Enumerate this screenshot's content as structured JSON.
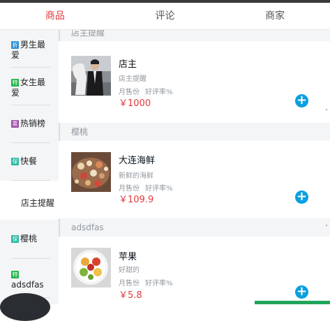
{
  "tabs": [
    {
      "label": "商品",
      "active": true
    },
    {
      "label": "评论",
      "active": false
    },
    {
      "label": "商家",
      "active": false
    }
  ],
  "sidebar": {
    "items": [
      {
        "label": "男生最爱",
        "badge": "折",
        "badge_color": "#2a8fd5"
      },
      {
        "label": "女生最爱",
        "badge": "特",
        "badge_color": "#21b34b"
      },
      {
        "label": "热销榜",
        "badge": "票",
        "badge_color": "#9b4ca3"
      },
      {
        "label": "快餐",
        "badge": "保",
        "badge_color": "#27b8a0"
      },
      {
        "label": "店主提醒",
        "badge": "",
        "badge_color": ""
      },
      {
        "label": "樱桃",
        "badge": "保",
        "badge_color": "#27b8a0"
      },
      {
        "label": "adsdfas",
        "badge": "特",
        "badge_color": "#21b34b"
      }
    ]
  },
  "sections": [
    {
      "title": "店主提醒",
      "food": {
        "name": "店主",
        "desc": "店主提醒",
        "sales": "月售份",
        "rating": "好评率%",
        "price": "￥1000",
        "image": "person-with-horse-photo"
      }
    },
    {
      "title": "樱桃",
      "food": {
        "name": "大连海鲜",
        "desc": "新鲜的海鲜",
        "sales": "月售份",
        "rating": "好评率%",
        "price": "￥109.9",
        "image": "seafood-platter-photo"
      }
    },
    {
      "title": "adsdfas",
      "food": {
        "name": "苹果",
        "desc": "好甜的",
        "sales": "月售份",
        "rating": "好评率%",
        "price": "￥5.8",
        "image": "fruit-plate-photo"
      }
    }
  ],
  "colors": {
    "accent": "#e4393c",
    "add_button": "#0a9fe0"
  },
  "add_icon": "+"
}
